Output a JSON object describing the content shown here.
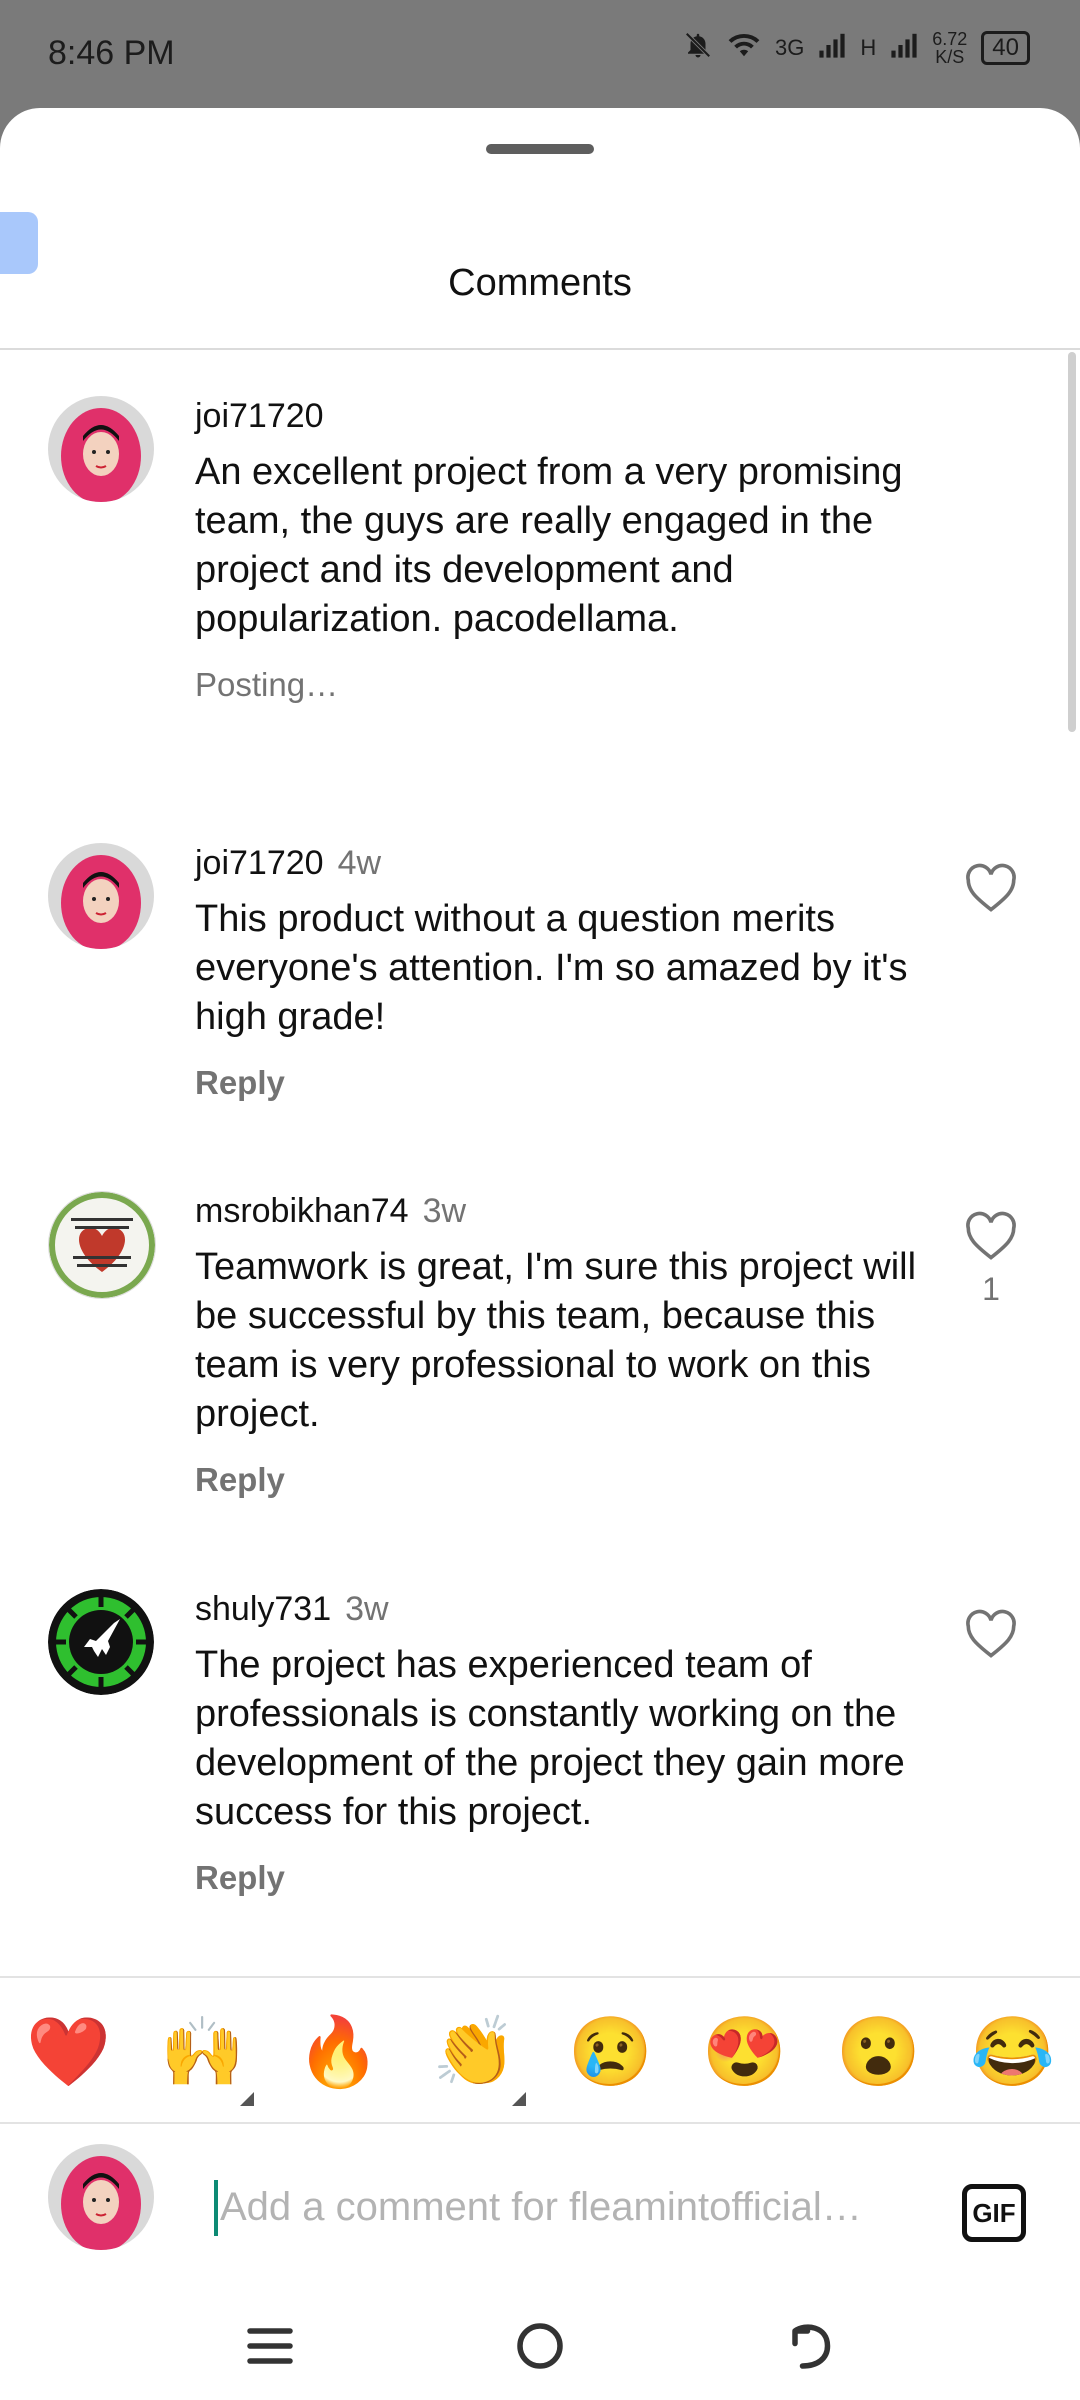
{
  "status_bar": {
    "time": "8:46 PM",
    "network_3g": "3G",
    "network_h": "H",
    "speed_value": "6.72",
    "speed_unit": "K/S",
    "battery": "40"
  },
  "sheet": {
    "title": "Comments"
  },
  "comments": [
    {
      "username": "joi71720",
      "time": "",
      "text": "An excellent project from a very promising team, the guys are really engaged in the project and its development and popularization. pacodellama.",
      "action": "Posting…",
      "likes": ""
    },
    {
      "username": "joi71720",
      "time": "4w",
      "text": "This product without a question merits everyone's attention. I'm so amazed by it's high grade!",
      "action": "Reply",
      "likes": ""
    },
    {
      "username": "msrobikhan74",
      "time": "3w",
      "text": "Teamwork is great, I'm sure this project will be successful by this team, because this team is very professional to work on this project.",
      "action": "Reply",
      "likes": "1"
    },
    {
      "username": "shuly731",
      "time": "3w",
      "text": "The project has experienced team of professionals is constantly working on the development of the project they gain more success for this project.",
      "action": "Reply",
      "likes": ""
    }
  ],
  "emoji_bar": [
    "❤️",
    "🙌",
    "🔥",
    "👏",
    "😢",
    "😍",
    "😮",
    "😂"
  ],
  "composer": {
    "placeholder": "Add a comment for fleamintofficial…",
    "gif_label": "GIF"
  },
  "icons": {
    "like": "heart-outline-icon",
    "menu": "menu-icon",
    "home": "home-circle-icon",
    "back": "back-arrow-icon"
  }
}
